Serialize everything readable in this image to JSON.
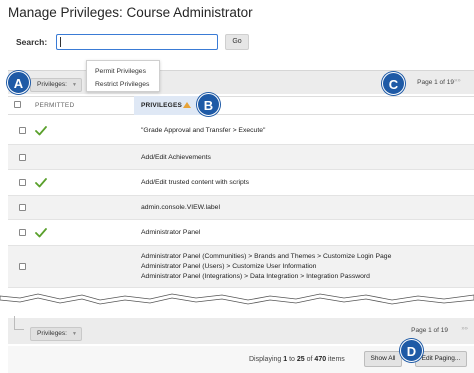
{
  "page_title": "Manage Privileges: Course Administrator",
  "search": {
    "label": "Search:",
    "value": "",
    "go_label": "Go"
  },
  "action_bar": {
    "privileges_button": "Privileges:",
    "menu": [
      "Permit Privileges",
      "Restrict Privileges"
    ],
    "paging": "Page 1 of 19",
    "paging_arrows": "»»"
  },
  "table": {
    "columns": [
      "PERMITTED",
      "PRIVILEGES"
    ],
    "sort_indicator": "ascending",
    "rows": [
      {
        "permitted": true,
        "lines": [
          "\"Grade Approval and Transfer > Execute\""
        ]
      },
      {
        "permitted": false,
        "lines": [
          "Add/Edit Achievements"
        ]
      },
      {
        "permitted": true,
        "lines": [
          "Add/Edit trusted content with scripts"
        ]
      },
      {
        "permitted": false,
        "lines": [
          "admin.console.VIEW.label"
        ]
      },
      {
        "permitted": true,
        "lines": [
          "Administrator Panel"
        ]
      },
      {
        "permitted": false,
        "lines": [
          "Administrator Panel (Communities) > Brands and Themes > Customize Login Page",
          "Administrator Panel (Users) > Customize User Information",
          "Administrator Panel (Integrations) > Data Integration > Integration Password"
        ]
      }
    ]
  },
  "bottom_bar": {
    "privileges_button": "Privileges:",
    "paging": "Page 1 of 19",
    "paging_arrows": "»»"
  },
  "footer": {
    "displaying_prefix": "Displaying ",
    "range_start": "1",
    "to": " to ",
    "range_end": "25",
    "of": " of ",
    "total": "470",
    "suffix": " items",
    "show_all_label": "Show All",
    "edit_paging_label": "Edit Paging..."
  },
  "markers": [
    "A",
    "B",
    "C",
    "D"
  ],
  "colors": {
    "marker": "#1e5aa6",
    "check": "#5aa02c",
    "sort": "#e7a33a",
    "focus": "#3a7bd5"
  }
}
